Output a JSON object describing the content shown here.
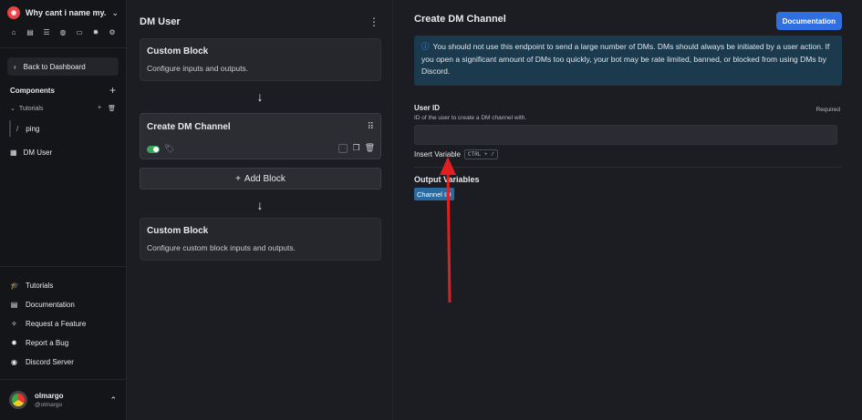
{
  "sidebar": {
    "server_name": "Why cant i name my...",
    "back_label": "Back to Dashboard",
    "components_label": "Components",
    "tutorials_folder": "Tutorials",
    "ping_label": "ping",
    "dm_user_label": "DM User",
    "links": [
      {
        "label": "Tutorials",
        "icon": "graduation-cap-icon"
      },
      {
        "label": "Documentation",
        "icon": "document-icon"
      },
      {
        "label": "Request a Feature",
        "icon": "sparkle-icon"
      },
      {
        "label": "Report a Bug",
        "icon": "bug-icon"
      },
      {
        "label": "Discord Server",
        "icon": "discord-icon"
      }
    ],
    "user": {
      "name": "olmargo",
      "handle": "@olmargo"
    }
  },
  "middle": {
    "title": "DM User",
    "block1": {
      "title": "Custom Block",
      "desc": "Configure inputs and outputs."
    },
    "active_block": {
      "title": "Create DM Channel"
    },
    "add_block_label": "Add Block",
    "block3": {
      "title": "Custom Block",
      "desc": "Configure custom block inputs and outputs."
    }
  },
  "right": {
    "title": "Create DM Channel",
    "doc_button": "Documentation",
    "info_text": "You should not use this endpoint to send a large number of DMs. DMs should always be initiated by a user action. If you open a significant amount of DMs too quickly, your bot may be rate limited, banned, or blocked from using DMs by Discord.",
    "field": {
      "label": "User ID",
      "required": "Required",
      "hint": "ID of the user to create a DM channel with.",
      "value": ""
    },
    "insert_variable": "Insert Variable",
    "shortcut": "CTRL + /",
    "output_title": "Output Variables",
    "output_chip": "Channel ID"
  },
  "colors": {
    "accent": "#2f6fe0",
    "info_bg": "#1c3a4d",
    "annotation": "#e02020",
    "toggle_on": "#3ba55d"
  }
}
